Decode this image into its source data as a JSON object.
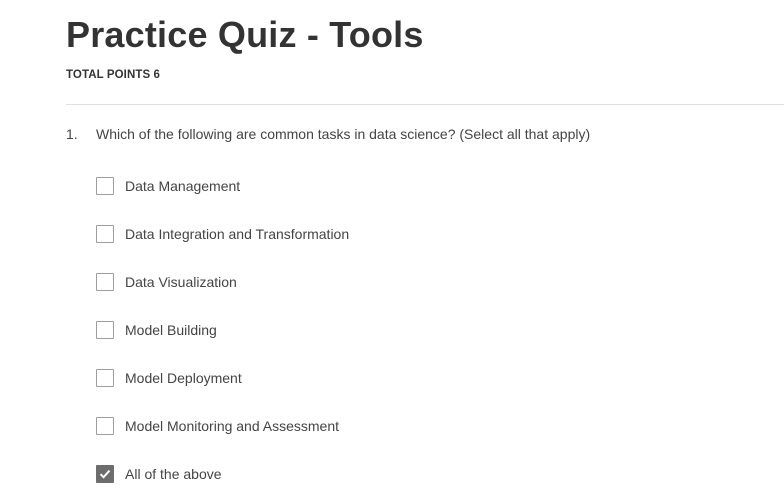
{
  "quiz": {
    "title": "Practice Quiz - Tools",
    "total_points": "TOTAL POINTS 6"
  },
  "question": {
    "number": "1.",
    "text": "Which of the following are common tasks in data science? (Select all that apply)",
    "options": [
      {
        "label": "Data Management",
        "checked": false
      },
      {
        "label": "Data Integration and Transformation",
        "checked": false
      },
      {
        "label": "Data Visualization",
        "checked": false
      },
      {
        "label": "Model Building",
        "checked": false
      },
      {
        "label": "Model Deployment",
        "checked": false
      },
      {
        "label": "Model Monitoring and Assessment",
        "checked": false
      },
      {
        "label": "All of the above",
        "checked": true
      }
    ]
  },
  "icons": {
    "checkbox_checked": "check-icon"
  }
}
